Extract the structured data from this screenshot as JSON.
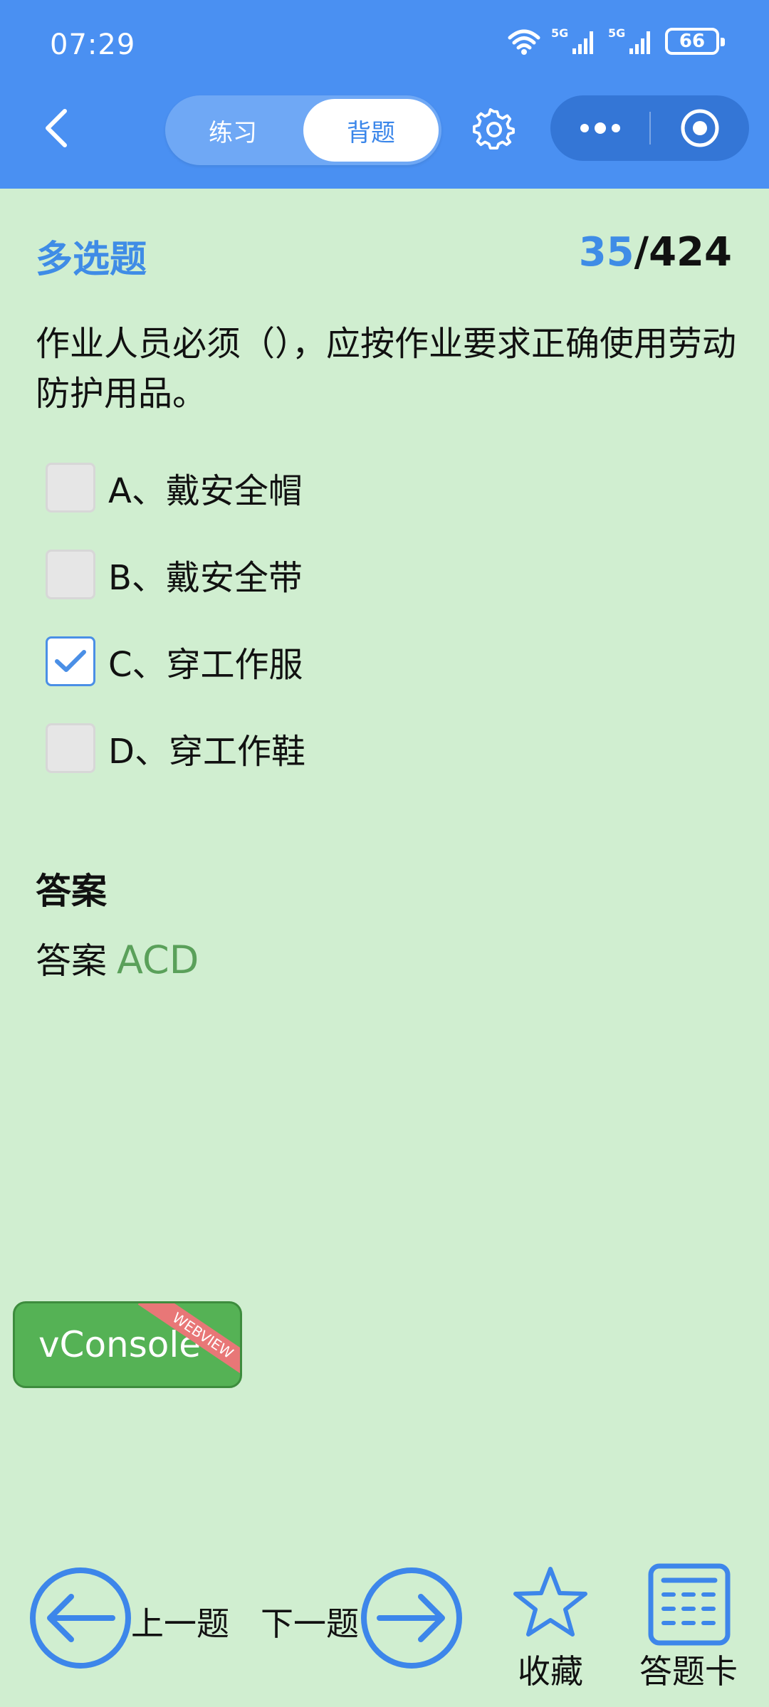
{
  "status_bar": {
    "time": "07:29",
    "battery": "66",
    "icons": [
      "wifi-icon",
      "signal-5g-icon",
      "signal-5g-icon",
      "battery-icon"
    ]
  },
  "header": {
    "tabs": [
      {
        "label": "练习",
        "active": false
      },
      {
        "label": "背题",
        "active": true
      }
    ],
    "icons": [
      "back-arrow-icon",
      "gear-icon",
      "more-dots-icon",
      "close-target-icon"
    ]
  },
  "question": {
    "type": "多选题",
    "current": "35",
    "separator": "/",
    "total": "424",
    "text": "作业人员必须（），应按作业要求正确使用劳动防护用品。",
    "options": [
      {
        "label": "A、戴安全帽",
        "checked": false
      },
      {
        "label": "B、戴安全带",
        "checked": false
      },
      {
        "label": "C、穿工作服",
        "checked": true
      },
      {
        "label": "D、穿工作鞋",
        "checked": false
      }
    ]
  },
  "answer": {
    "title": "答案",
    "prefix": "答案",
    "value": "ACD"
  },
  "vconsole": {
    "label": "vConsole",
    "ribbon": "WEBVIEW"
  },
  "bottom_bar": {
    "prev_label": "上一题",
    "next_label": "下一题",
    "favorite_label": "收藏",
    "card_label": "答题卡"
  },
  "colors": {
    "header_bg": "#4a90f2",
    "page_bg": "#d0eed0",
    "accent_blue": "#3f8ce6",
    "answer_green": "#5aa05a",
    "vconsole_green": "#55b255"
  }
}
